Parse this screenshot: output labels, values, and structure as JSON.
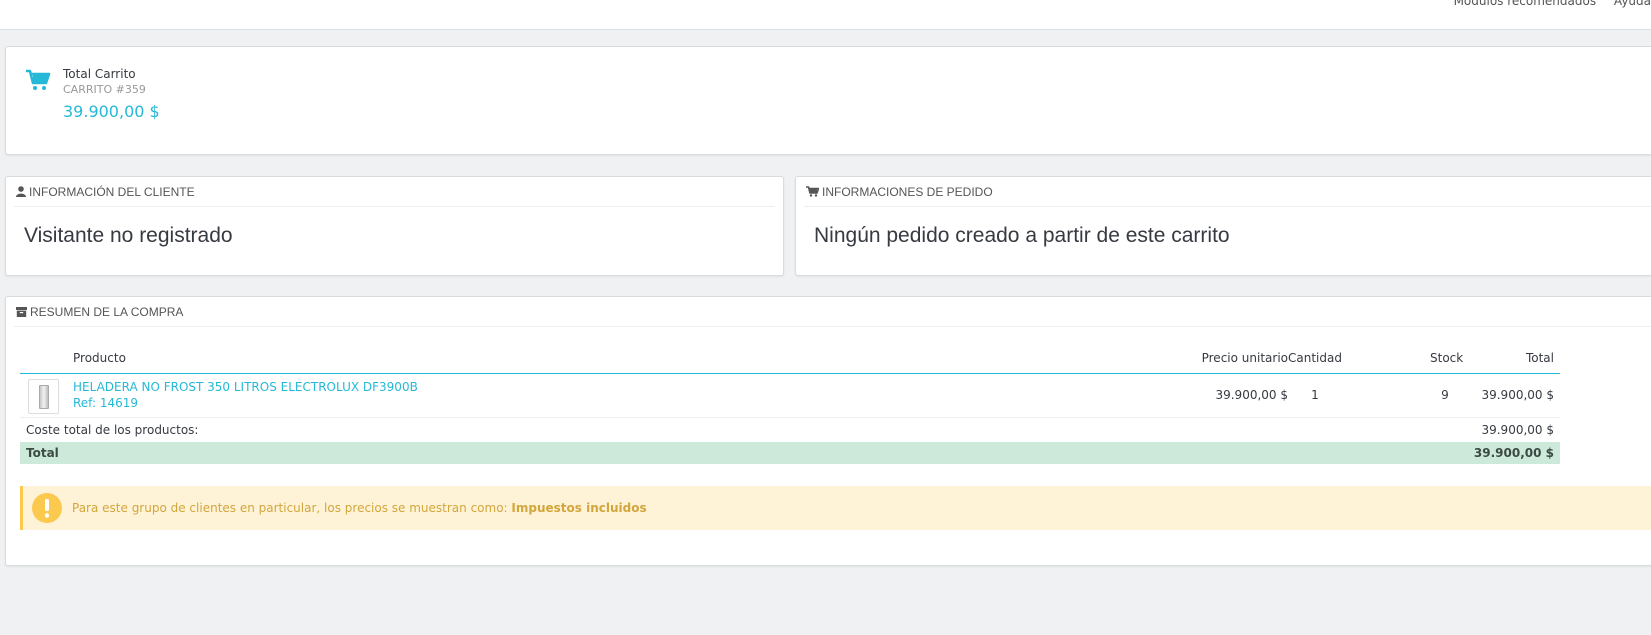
{
  "topbar": {
    "link_modules": "Módulos recomendados",
    "link_help": "Ayuda"
  },
  "kpi": {
    "title": "Total Carrito",
    "subtitle": "CARRITO #359",
    "value": "39.900,00 $"
  },
  "customer_panel": {
    "heading": "INFORMACIÓN DEL CLIENTE",
    "text": "Visitante no registrado"
  },
  "order_panel": {
    "heading": "INFORMACIONES DE PEDIDO",
    "text": "Ningún pedido creado a partir de este carrito"
  },
  "summary": {
    "heading": "RESUMEN DE LA COMPRA",
    "columns": {
      "product": "Producto",
      "unit_price": "Precio unitario",
      "quantity": "Cantidad",
      "stock": "Stock",
      "total": "Total"
    },
    "products": [
      {
        "name": "HELADERA NO FROST 350 LITROS ELECTROLUX DF3900B",
        "ref": "Ref: 14619",
        "unit_price": "39.900,00 $",
        "quantity": "1",
        "stock": "9",
        "total": "39.900,00 $"
      }
    ],
    "subtotal_label": "Coste total de los productos:",
    "subtotal_value": "39.900,00 $",
    "total_label": "Total",
    "total_value": "39.900,00 $"
  },
  "alert": {
    "text": "Para este grupo de clientes en particular, los precios se muestran como: ",
    "strong": "Impuestos incluidos"
  },
  "colors": {
    "accent": "#25b9d7",
    "total_row_bg": "#cde9da",
    "alert_bg": "#fff3d7",
    "alert_text": "#d2a63c",
    "alert_icon": "#fcc94f"
  },
  "icons": {
    "kpi": "shopping-cart-icon",
    "customer": "user-icon",
    "order": "shopping-cart-icon",
    "summary": "archive-icon",
    "alert": "exclamation-circle-icon"
  }
}
